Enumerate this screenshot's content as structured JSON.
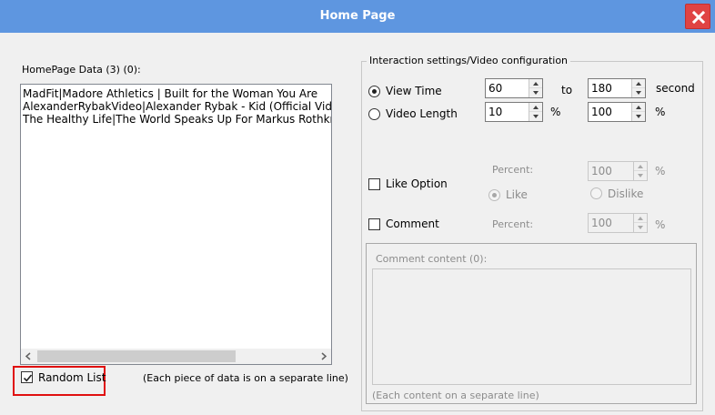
{
  "window": {
    "title": "Home Page",
    "close_icon": "close-icon",
    "titlebar_color": "#5e96e0",
    "close_color": "#e04343"
  },
  "homepage": {
    "label": "HomePage Data (3) (0):",
    "items": [
      "MadFit|Madore Athletics | Built for the Woman You Are",
      "AlexanderRybakVideo|Alexander Rybak - Kid (Official Video)",
      "The Healthy Life|The World Speaks Up For Markus Rothkranz - Pe"
    ],
    "random_list": {
      "label": "Random List",
      "checked": true
    },
    "hint": "(Each piece of data is on a separate line)"
  },
  "settings": {
    "group_label": "Interaction settings/Video configuration",
    "view_time": {
      "label": "View Time",
      "selected": true,
      "from": "60",
      "to_label": "to",
      "to": "180",
      "unit": "second"
    },
    "video_length": {
      "label": "Video Length",
      "selected": false,
      "from": "10",
      "from_unit": "%",
      "to": "100",
      "to_unit": "%"
    },
    "like_option": {
      "label": "Like Option",
      "checked": false,
      "percent_label": "Percent:",
      "percent": "100",
      "unit": "%",
      "like_label": "Like",
      "dislike_label": "Dislike"
    },
    "comment": {
      "label": "Comment",
      "checked": false,
      "percent_label": "Percent:",
      "percent": "100",
      "unit": "%",
      "content_label": "Comment content (0):",
      "content_hint": "(Each content on a separate line)"
    }
  },
  "highlight_color": "#e01010"
}
